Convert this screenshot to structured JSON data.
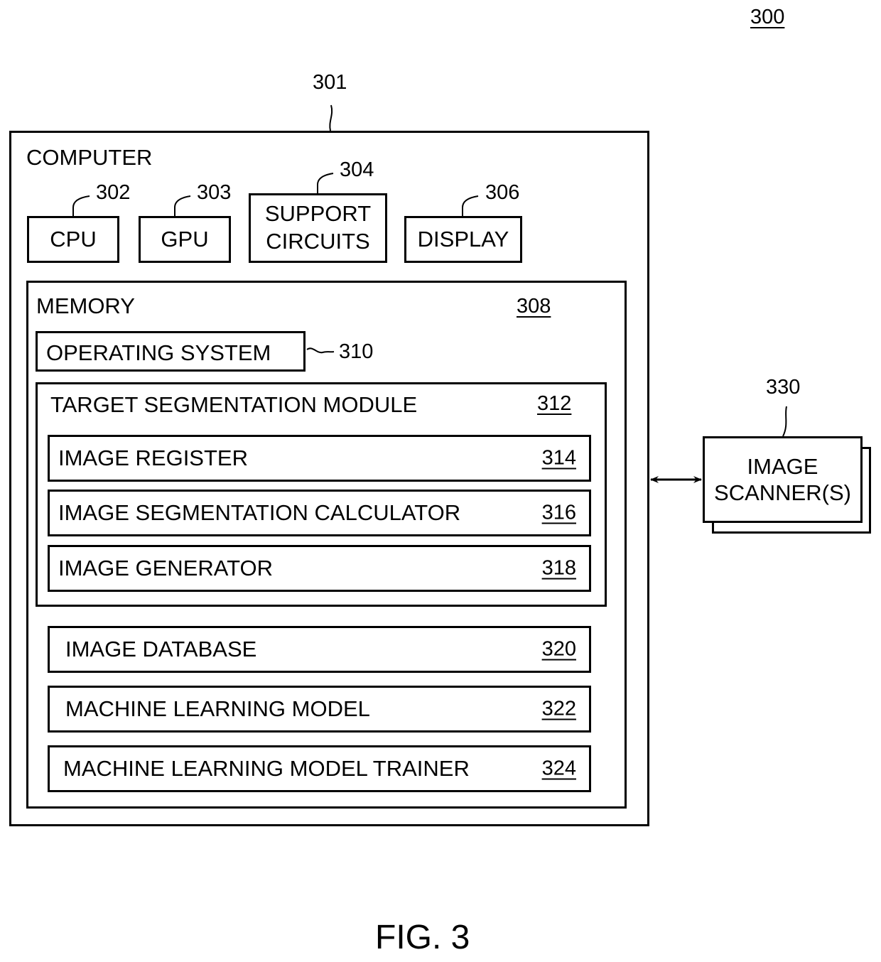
{
  "figure_number": "300",
  "caption": "FIG. 3",
  "computer": {
    "ref": "301",
    "label": "COMPUTER",
    "components": [
      {
        "ref": "302",
        "label": "CPU"
      },
      {
        "ref": "303",
        "label": "GPU"
      },
      {
        "ref": "304",
        "label_line1": "SUPPORT",
        "label_line2": "CIRCUITS"
      },
      {
        "ref": "306",
        "label": "DISPLAY"
      }
    ],
    "memory": {
      "label": "MEMORY",
      "ref": "308",
      "operating_system": {
        "label": "OPERATING SYSTEM",
        "ref": "310"
      },
      "target_segmentation_module": {
        "label": "TARGET SEGMENTATION MODULE",
        "ref": "312",
        "items": [
          {
            "label": "IMAGE REGISTER",
            "ref": "314"
          },
          {
            "label": "IMAGE SEGMENTATION CALCULATOR",
            "ref": "316"
          },
          {
            "label": "IMAGE GENERATOR",
            "ref": "318"
          }
        ]
      },
      "items": [
        {
          "label": "IMAGE DATABASE",
          "ref": "320"
        },
        {
          "label": "MACHINE LEARNING MODEL",
          "ref": "322"
        },
        {
          "label": "MACHINE LEARNING MODEL TRAINER",
          "ref": "324"
        }
      ]
    }
  },
  "image_scanner": {
    "ref": "330",
    "label_line1": "IMAGE",
    "label_line2": "SCANNER(S)"
  }
}
